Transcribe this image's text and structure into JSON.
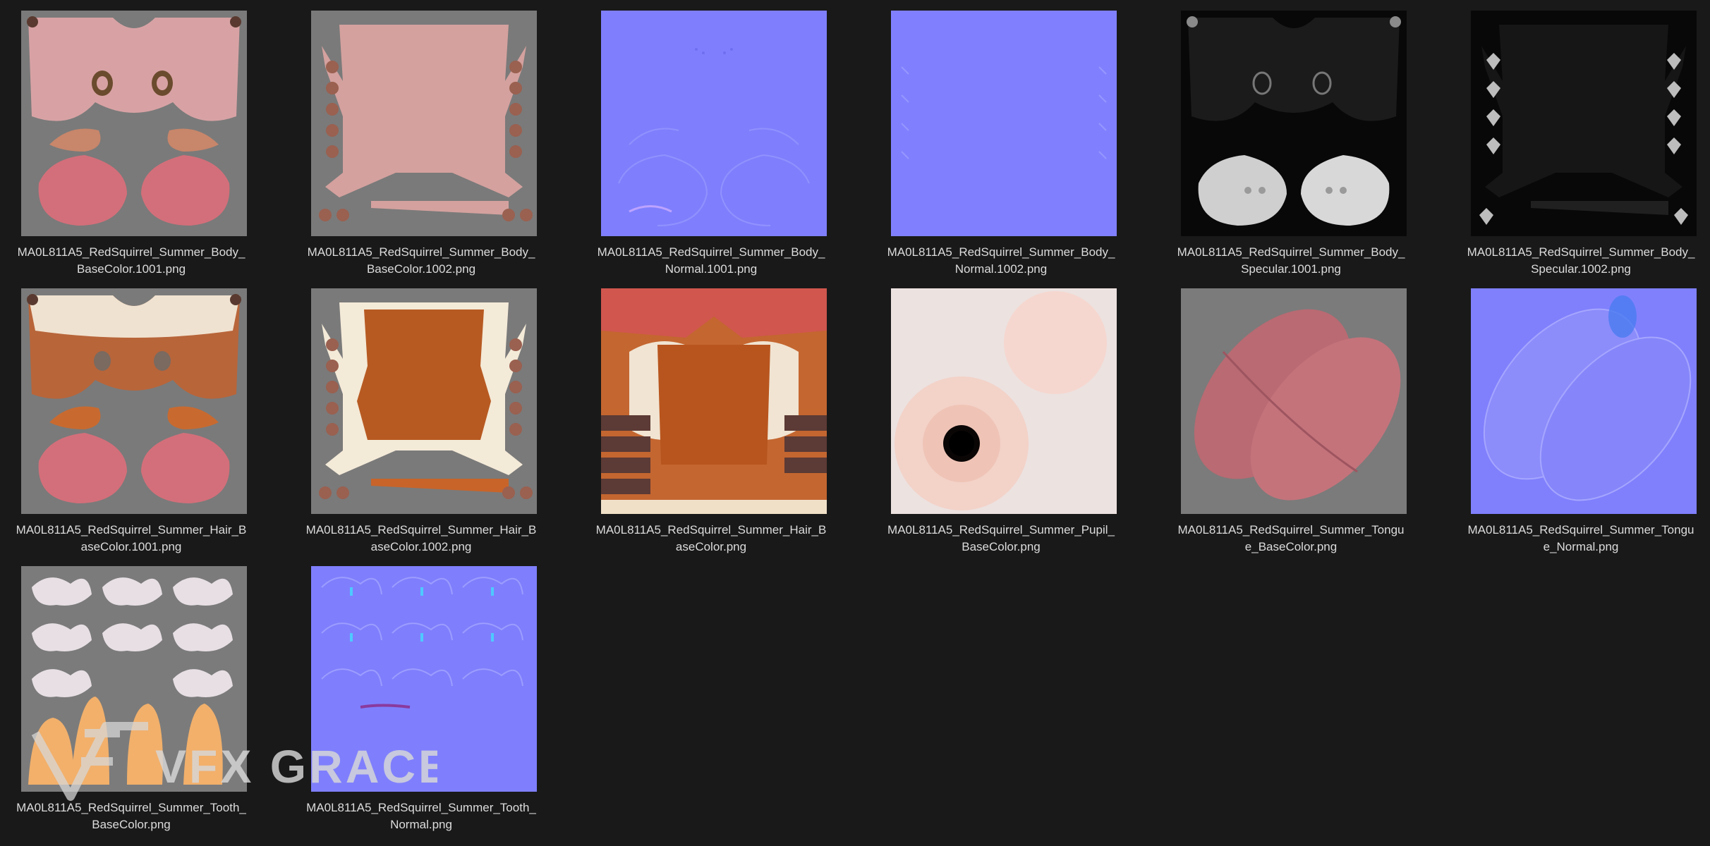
{
  "files": [
    {
      "line1": "MA0L811A5_RedSquirrel_Summer_Body_",
      "line2": "BaseColor.1001.png",
      "kind": "body-base-1001"
    },
    {
      "line1": "MA0L811A5_RedSquirrel_Summer_Body_",
      "line2": "BaseColor.1002.png",
      "kind": "body-base-1002"
    },
    {
      "line1": "MA0L811A5_RedSquirrel_Summer_Body_",
      "line2": "Normal.1001.png",
      "kind": "body-normal-1001"
    },
    {
      "line1": "MA0L811A5_RedSquirrel_Summer_Body_",
      "line2": "Normal.1002.png",
      "kind": "body-normal-1002"
    },
    {
      "line1": "MA0L811A5_RedSquirrel_Summer_Body_",
      "line2": "Specular.1001.png",
      "kind": "body-spec-1001"
    },
    {
      "line1": "MA0L811A5_RedSquirrel_Summer_Body_",
      "line2": "Specular.1002.png",
      "kind": "body-spec-1002"
    },
    {
      "line1": "MA0L811A5_RedSquirrel_Summer_Hair_B",
      "line2": "aseColor.1001.png",
      "kind": "hair-base-1001"
    },
    {
      "line1": "MA0L811A5_RedSquirrel_Summer_Hair_B",
      "line2": "aseColor.1002.png",
      "kind": "hair-base-1002"
    },
    {
      "line1": "MA0L811A5_RedSquirrel_Summer_Hair_B",
      "line2": "aseColor.png",
      "kind": "hair-base"
    },
    {
      "line1": "MA0L811A5_RedSquirrel_Summer_Pupil_",
      "line2": "BaseColor.png",
      "kind": "pupil-base"
    },
    {
      "line1": "MA0L811A5_RedSquirrel_Summer_Tongu",
      "line2": "e_BaseColor.png",
      "kind": "tongue-base"
    },
    {
      "line1": "MA0L811A5_RedSquirrel_Summer_Tongu",
      "line2": "e_Normal.png",
      "kind": "tongue-normal"
    },
    {
      "line1": "MA0L811A5_RedSquirrel_Summer_Tooth_",
      "line2": "BaseColor.png",
      "kind": "tooth-base"
    },
    {
      "line1": "MA0L811A5_RedSquirrel_Summer_Tooth_",
      "line2": "Normal.png",
      "kind": "tooth-normal"
    }
  ],
  "watermark": {
    "text": "VFX GRACE"
  },
  "colors": {
    "background": "#191919",
    "label": "#dcdcdc",
    "uv_gray": "#7a7a7a",
    "normal_blue": "#7f7ffd",
    "skin_pink": "#d9a3a3",
    "fur_orange": "#c8642a",
    "specular_black": "#080808"
  }
}
